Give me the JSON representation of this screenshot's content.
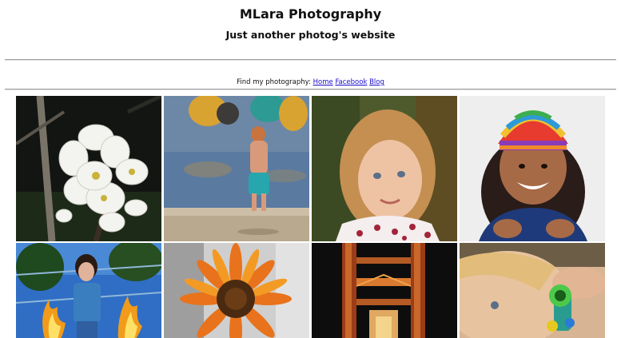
{
  "site": {
    "title": "MLara Photography",
    "tagline": "Just another photog's website"
  },
  "nav": {
    "label": "Find my photography:",
    "links": [
      "Home",
      "Facebook",
      "Blog"
    ]
  },
  "gallery": {
    "photos": [
      {
        "subject": "white blossoms"
      },
      {
        "subject": "toddler at beach"
      },
      {
        "subject": "blonde girl portrait"
      },
      {
        "subject": "girl in rainbow hat"
      },
      {
        "subject": "girl with fire"
      },
      {
        "subject": "sunflower"
      },
      {
        "subject": "golden gate at night"
      },
      {
        "subject": "child with toy"
      }
    ]
  },
  "colors": {
    "link": "#1a0dcc",
    "rule": "#9a9a9a"
  }
}
